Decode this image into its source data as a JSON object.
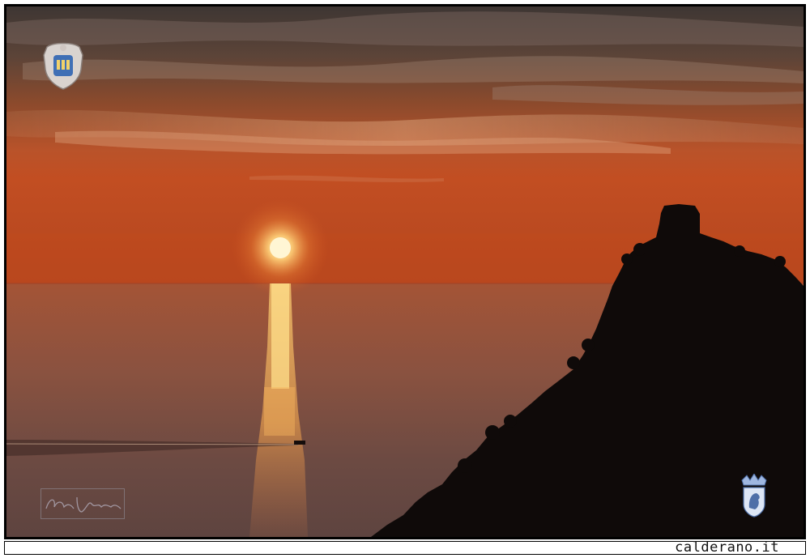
{
  "site": {
    "label": "calderano.it"
  },
  "colors": {
    "sky_top": "#4a3a34",
    "sky_mid": "#b5532a",
    "horizon": "#c84e1f",
    "sea_near": "#5a3a30",
    "sun": "#fff4c8",
    "silhouette": "#0f0a09"
  },
  "icons": {
    "crest": "coat-of-arms-icon",
    "signature": "signature-icon",
    "emblem": "crowned-lion-emblem-icon"
  }
}
